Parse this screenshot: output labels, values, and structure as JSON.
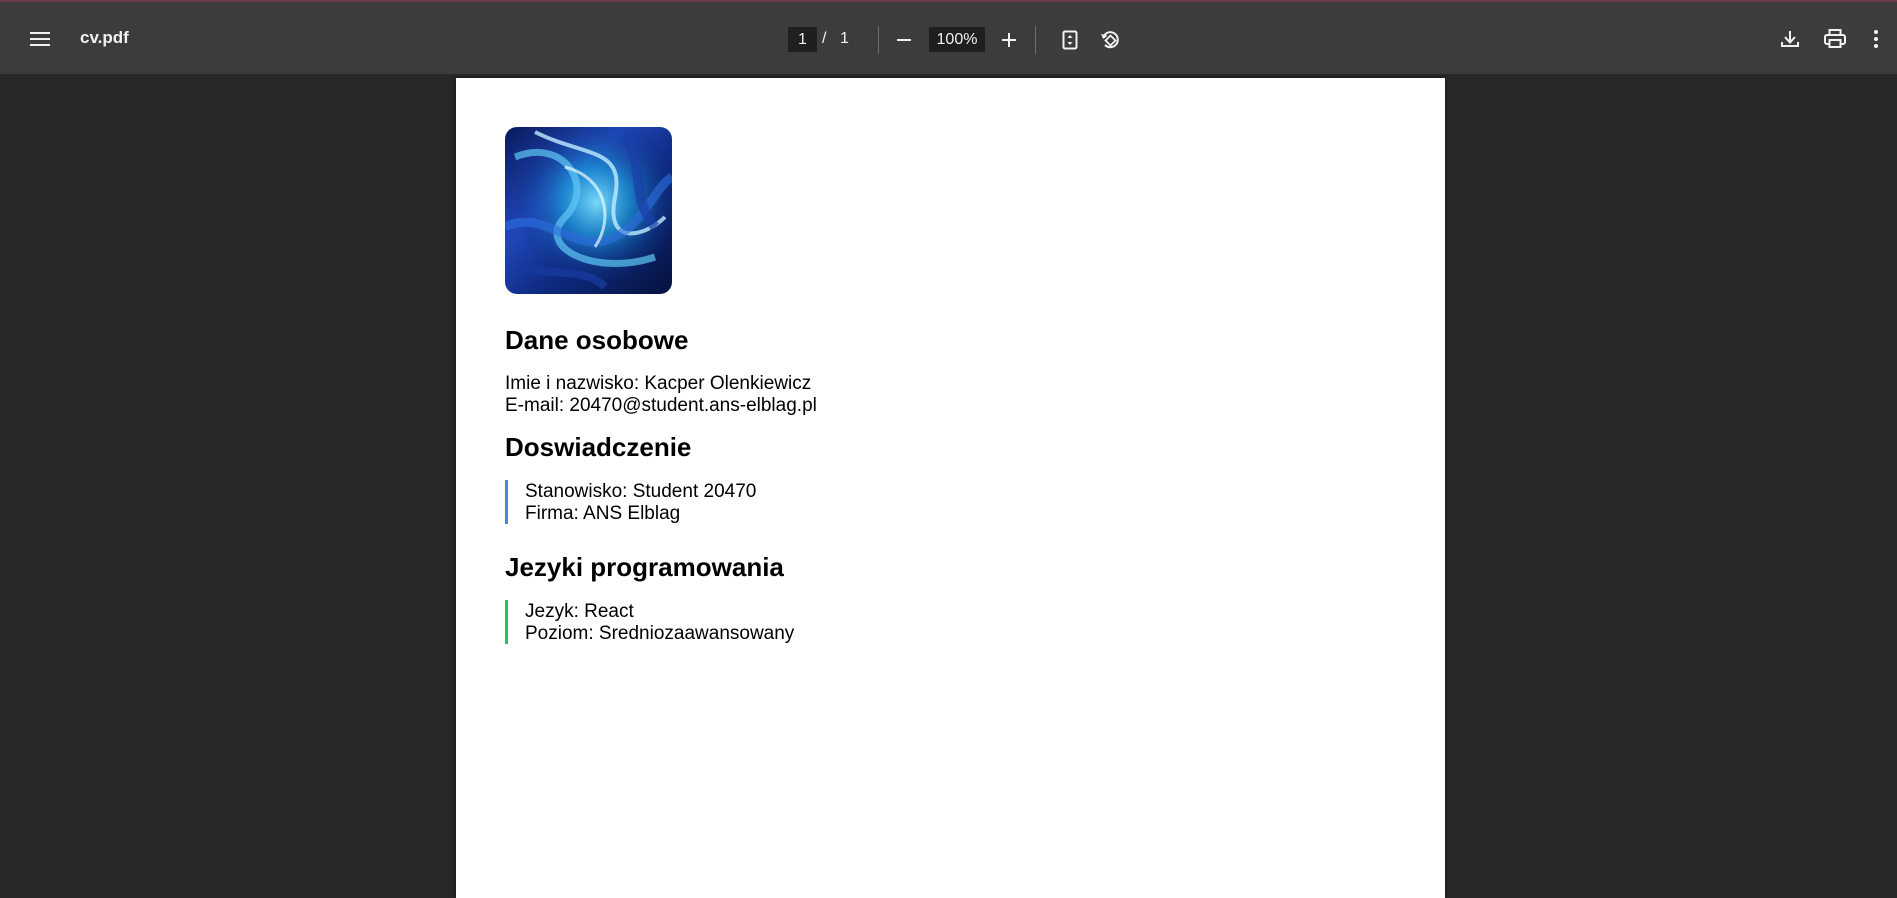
{
  "toolbar": {
    "title": "cv.pdf",
    "page_current": "1",
    "page_separator": "/",
    "page_total": "1",
    "zoom": "100%"
  },
  "document": {
    "sections": {
      "personal": {
        "heading": "Dane osobowe",
        "name_line": "Imie i nazwisko: Kacper Olenkiewicz",
        "email_line": "E-mail: 20470@student.ans-elblag.pl"
      },
      "experience": {
        "heading": "Doswiadczenie",
        "position_line": "Stanowisko: Student 20470",
        "company_line": "Firma: ANS Elblag",
        "accent": "#3b8fd9"
      },
      "languages": {
        "heading": "Jezyki programowania",
        "language_line": "Jezyk: React",
        "level_line": "Poziom: Sredniozaawansowany",
        "accent": "#2ebc6a"
      }
    }
  },
  "colors": {
    "toolbar_bg": "#3c3c3c",
    "viewer_bg": "#282828",
    "page_bg": "#ffffff"
  }
}
